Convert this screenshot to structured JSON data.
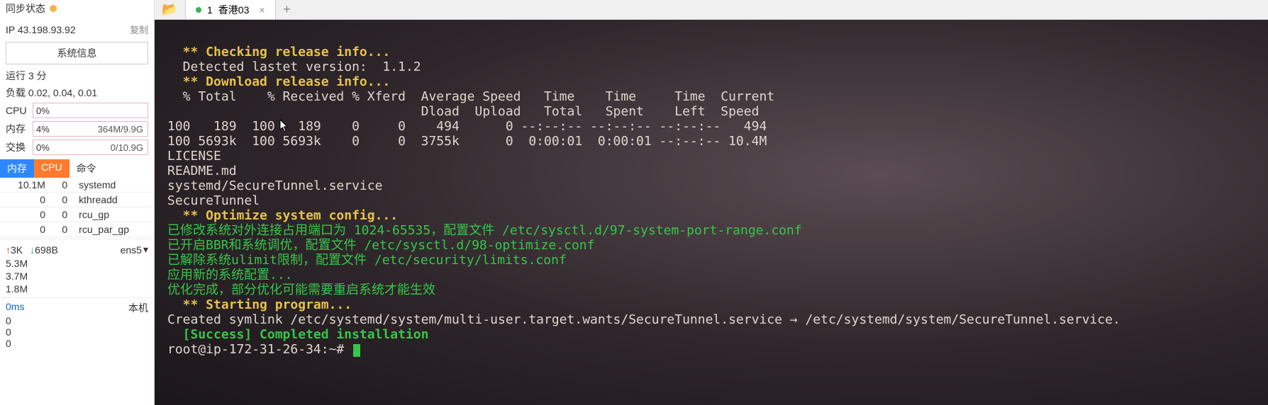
{
  "sidebar": {
    "sync_label": "同步状态",
    "ip_label": "IP",
    "ip_value": "43.198.93.92",
    "copy_label": "复制",
    "sysinfo_btn": "系统信息",
    "uptime": "运行 3 分",
    "load_label": "负载",
    "load_value": "0.02, 0.04, 0.01",
    "cpu_label": "CPU",
    "cpu_pct": "0%",
    "mem_label": "内存",
    "mem_pct": "4%",
    "mem_detail": "364M/9.9G",
    "swap_label": "交换",
    "swap_pct": "0%",
    "swap_detail": "0/10.9G",
    "proc_tabs": {
      "mem": "内存",
      "cpu": "CPU",
      "cmd": "命令"
    },
    "procs": [
      {
        "mem": "10.1M",
        "cpu": "0",
        "name": "systemd"
      },
      {
        "mem": "0",
        "cpu": "0",
        "name": "kthreadd"
      },
      {
        "mem": "0",
        "cpu": "0",
        "name": "rcu_gp"
      },
      {
        "mem": "0",
        "cpu": "0",
        "name": "rcu_par_gp"
      }
    ],
    "net_up": "3K",
    "net_down": "698B",
    "iface": "ens5",
    "graph_y": [
      "5.3M",
      "3.7M",
      "1.8M"
    ],
    "lat_ms": "0ms",
    "local_label": "本机",
    "lat_zeros": [
      "0",
      "0",
      "0"
    ]
  },
  "tabbar": {
    "tab_prefix": "1",
    "tab_title": "香港03",
    "close": "×",
    "add": "+"
  },
  "terminal": {
    "l1": "  ** Checking release info...",
    "l2": "  Detected lastet version:  1.1.2",
    "l3": "  ** Download release info...",
    "l4": "  % Total    % Received % Xferd  Average Speed   Time    Time     Time  Current",
    "l5": "                                 Dload  Upload   Total   Spent    Left  Speed",
    "l6": "100   189  100   189    0     0    494      0 --:--:-- --:--:-- --:--:--   494",
    "l7": "100 5693k  100 5693k    0     0  3755k      0  0:00:01  0:00:01 --:--:-- 10.4M",
    "l8": "LICENSE",
    "l9": "README.md",
    "l10": "systemd/SecureTunnel.service",
    "l11": "SecureTunnel",
    "l12": "  ** Optimize system config...",
    "l13": "已修改系统对外连接占用端口为 1024-65535，配置文件 /etc/sysctl.d/97-system-port-range.conf",
    "l14": "已开启BBR和系统调优，配置文件 /etc/sysctl.d/98-optimize.conf",
    "l15": "已解除系统ulimit限制，配置文件 /etc/security/limits.conf",
    "l16": "应用新的系统配置...",
    "l17": "优化完成，部分优化可能需要重启系统才能生效",
    "l18": "  ** Starting program...",
    "l19": "Created symlink /etc/systemd/system/multi-user.target.wants/SecureTunnel.service → /etc/systemd/system/SecureTunnel.service.",
    "l20": "  [Success] Completed installation",
    "prompt": "root@ip-172-31-26-34:~# "
  }
}
